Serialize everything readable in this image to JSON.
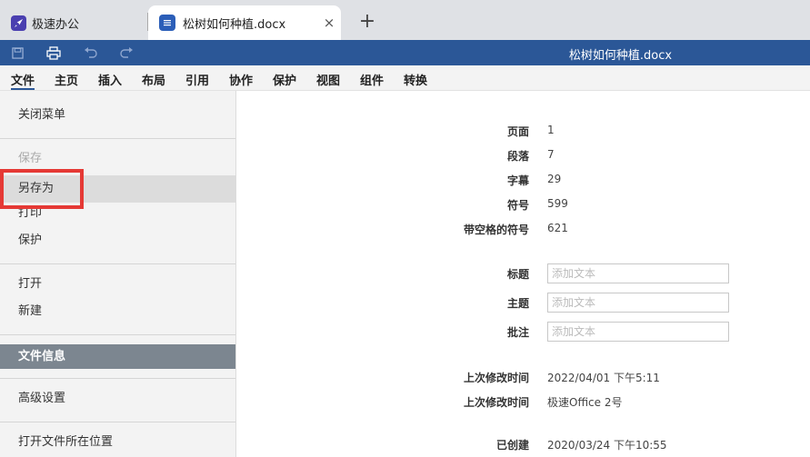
{
  "tabs": {
    "app_title": "极速办公",
    "doc_tab_title": "松树如何种植.docx",
    "close_glyph": "×",
    "new_tab_glyph": "+"
  },
  "titlebar": {
    "doc_title": "松树如何种植.docx",
    "bg_color": "#2b5797"
  },
  "menu": {
    "items": [
      "文件",
      "主页",
      "插入",
      "布局",
      "引用",
      "协作",
      "保护",
      "视图",
      "组件",
      "转换"
    ]
  },
  "sidebar": {
    "close_menu": "关闭菜单",
    "save": "保存",
    "save_as": "另存为",
    "print": "打印",
    "protect": "保护",
    "open": "打开",
    "new": "新建",
    "file_info": "文件信息",
    "advanced": "高级设置",
    "open_location": "打开文件所在位置"
  },
  "info": {
    "pages_label": "页面",
    "pages_value": "1",
    "paragraphs_label": "段落",
    "paragraphs_value": "7",
    "words_label": "字幕",
    "words_value": "29",
    "symbols_label": "符号",
    "symbols_value": "599",
    "symbols_spaces_label": "带空格的符号",
    "symbols_spaces_value": "621",
    "title_label": "标题",
    "subject_label": "主题",
    "comment_label": "批注",
    "input_placeholder": "添加文本",
    "modified_label": "上次修改时间",
    "modified_value": "2022/04/01 下午5:11",
    "modified_by_label": "上次修改时间",
    "modified_by_value": "极速Office 2号",
    "created_label": "已创建",
    "created_value": "2020/03/24 下午10:55"
  }
}
